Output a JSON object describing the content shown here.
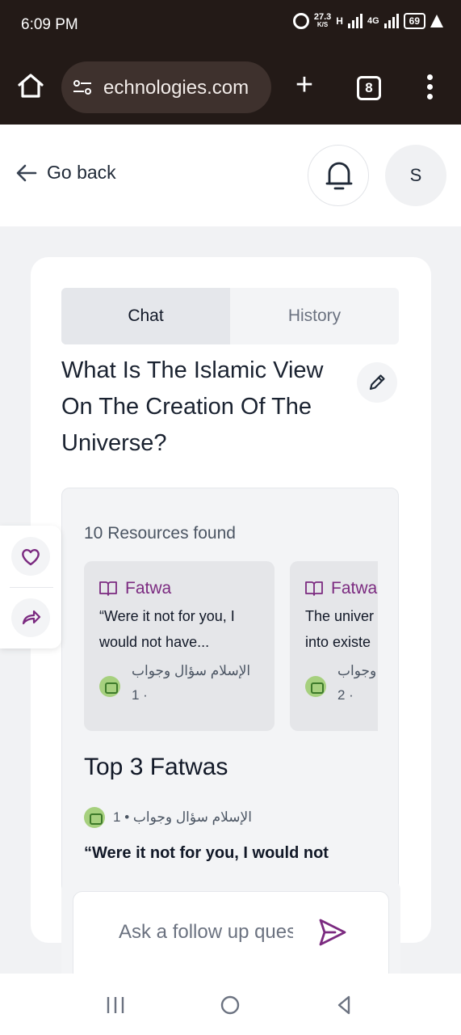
{
  "status_bar": {
    "time": "6:09 PM",
    "speed_value": "27.3",
    "speed_unit": "K/S",
    "network_h": "H",
    "network_4g": "4G",
    "battery": "69"
  },
  "browser": {
    "url": "echnologies.com",
    "tab_count": "8"
  },
  "header": {
    "back_label": "Go back",
    "avatar_initial": "S"
  },
  "tabs": [
    {
      "label": "Chat",
      "active": true
    },
    {
      "label": "History",
      "active": false
    }
  ],
  "question_title": "What Is The Islamic View On The Creation Of The Universe?",
  "resources": {
    "count_label": "10 Resources found",
    "items": [
      {
        "type": "Fatwa",
        "excerpt_line1": "“Were it not for you, I",
        "excerpt_line2": "would not have...",
        "source": "الإسلام سؤال وجواب",
        "index": "1 ·"
      },
      {
        "type": "Fatwa",
        "excerpt_line1": "The univer",
        "excerpt_line2": "into existe",
        "source": "وجواب",
        "index": "2 ·"
      }
    ]
  },
  "top_fatwas": {
    "heading": "Top 3 Fatwas",
    "source_line": "الإسلام سؤال وجواب • 1",
    "first_quote": "“Were it not for you, I would not"
  },
  "follow_up": {
    "placeholder": "Ask a follow up question"
  },
  "colors": {
    "accent_purple": "#7b2a80",
    "browser_bar": "#231a17",
    "source_logo_green": "#a6d07e"
  }
}
